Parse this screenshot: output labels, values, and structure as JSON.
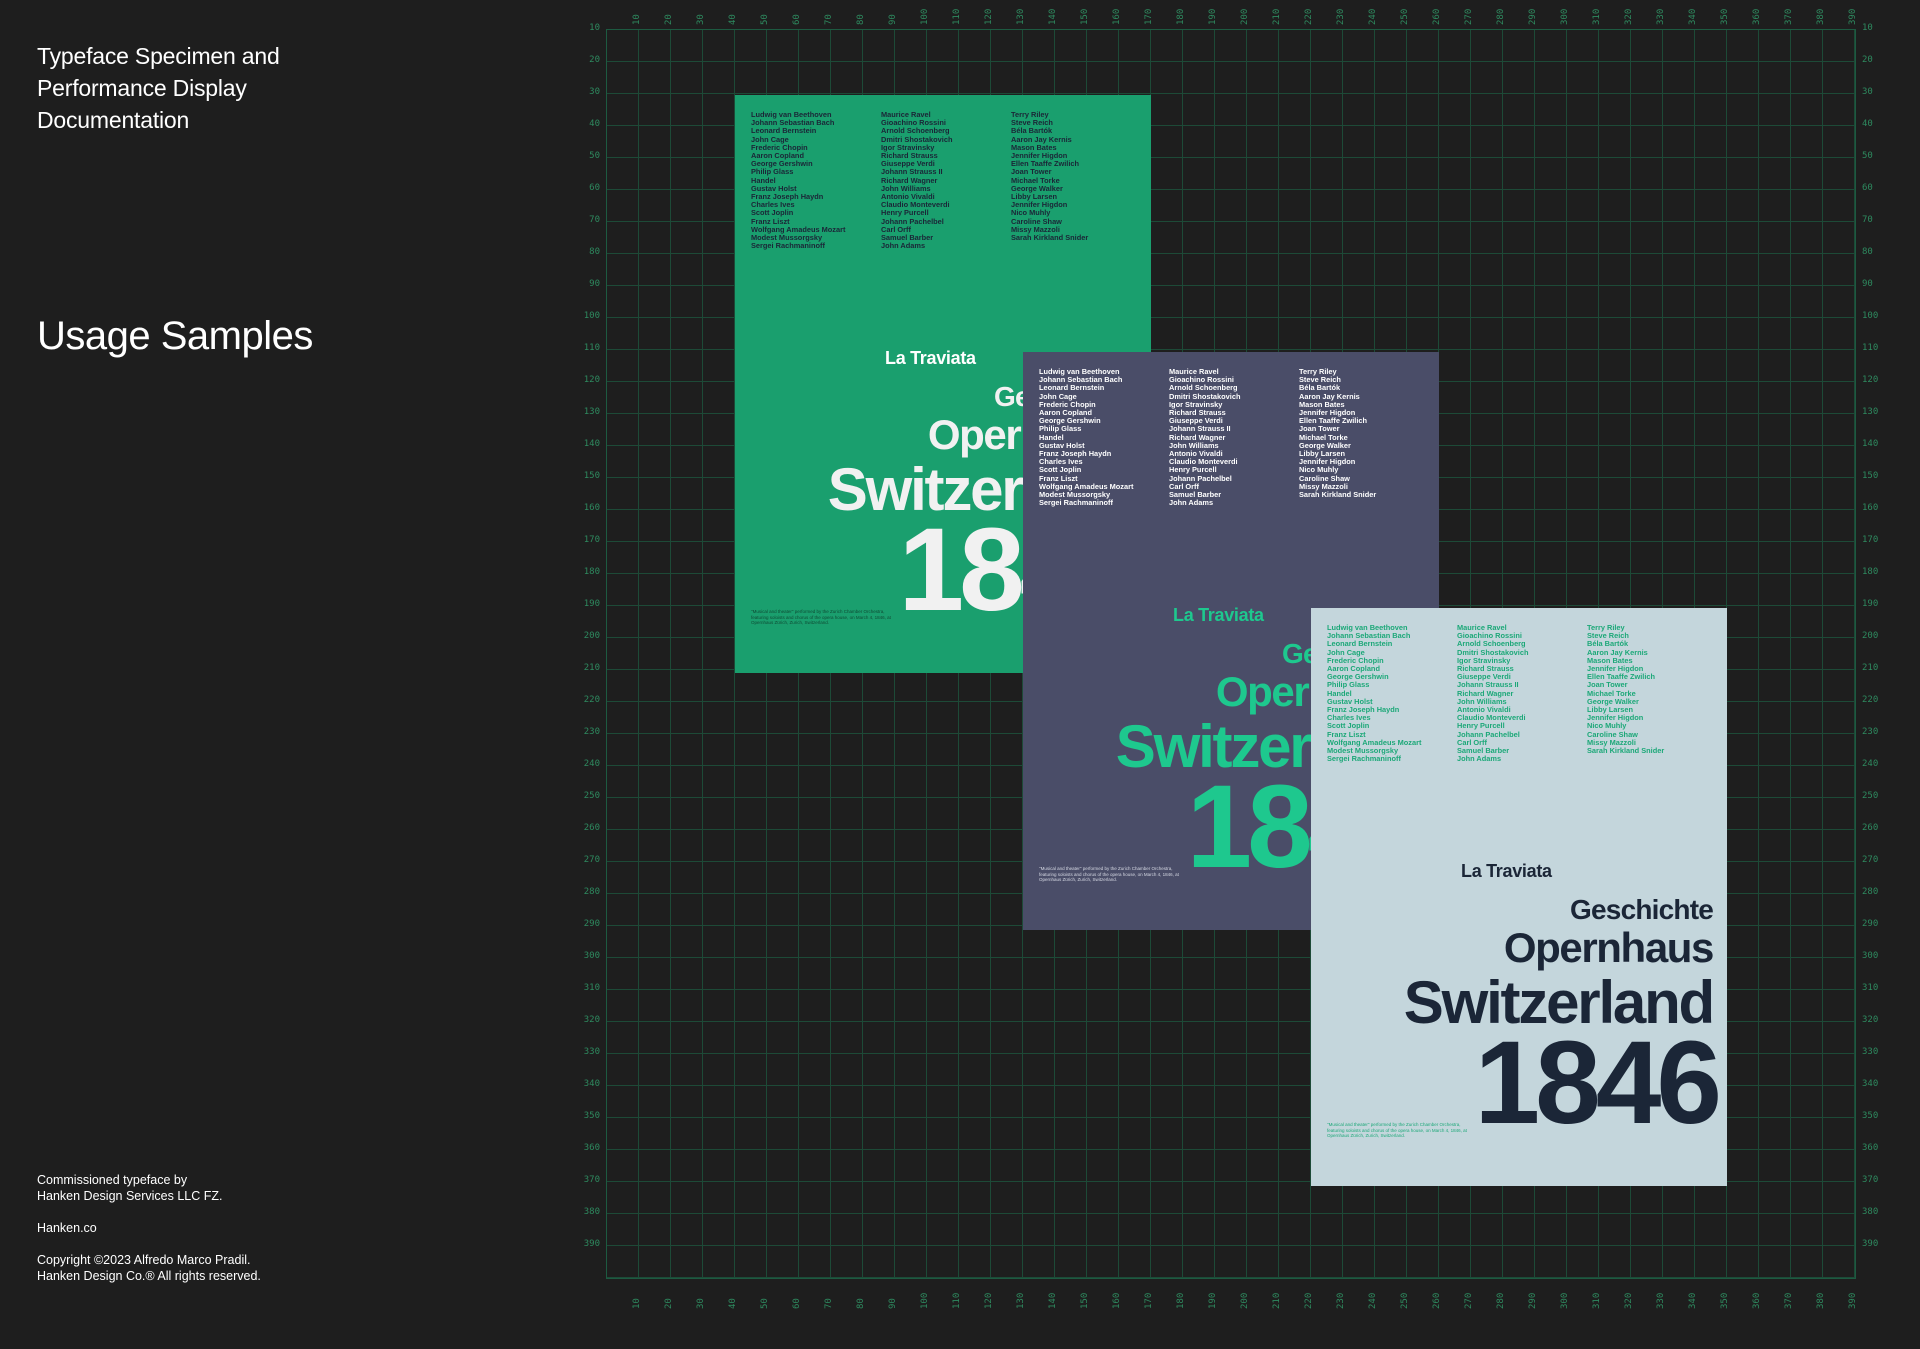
{
  "sidebar": {
    "title_lines": [
      "Typeface Specimen and",
      "Performance Display",
      "Documentation"
    ],
    "section_title": "Usage Samples",
    "credit_lines": [
      "Commissioned typeface by",
      "Hanken Design Services LLC FZ."
    ],
    "website": "Hanken.co",
    "copyright_lines": [
      "Copyright ©2023 Alfredo Marco Pradil.",
      "Hanken Design Co.® All rights reserved."
    ]
  },
  "grid": {
    "ticks": [
      "10",
      "20",
      "30",
      "40",
      "50",
      "60",
      "70",
      "80",
      "90",
      "100",
      "110",
      "120",
      "130",
      "140",
      "150",
      "160",
      "170",
      "180",
      "190",
      "200",
      "210",
      "220",
      "230",
      "240",
      "250",
      "260",
      "270",
      "280",
      "290",
      "300",
      "310",
      "320",
      "330",
      "340",
      "350",
      "360",
      "370",
      "380",
      "390"
    ],
    "line_color": "#1d4a37",
    "tick_color": "#2e8a5f"
  },
  "poster": {
    "composers_col1": [
      "Ludwig van Beethoven",
      "Johann Sebastian Bach",
      "Leonard Bernstein",
      "John Cage",
      "Frederic Chopin",
      "Aaron Copland",
      "George Gershwin",
      "Philip Glass",
      "Handel",
      "Gustav Holst",
      "Franz Joseph Haydn",
      "Charles Ives",
      "Scott Joplin",
      "Franz Liszt",
      "Wolfgang Amadeus Mozart",
      "Modest Mussorgsky",
      "Sergei Rachmaninoff"
    ],
    "composers_col2": [
      "Maurice Ravel",
      "Gioachino Rossini",
      "Arnold Schoenberg",
      "Dmitri Shostakovich",
      "Igor Stravinsky",
      "Richard Strauss",
      "Giuseppe Verdi",
      "Johann Strauss II",
      "Richard Wagner",
      "John Williams",
      "Antonio Vivaldi",
      "Claudio Monteverdi",
      "Henry Purcell",
      "Johann Pachelbel",
      "Carl Orff",
      "Samuel Barber",
      "John Adams"
    ],
    "composers_col3": [
      "Terry Riley",
      "Steve Reich",
      "Béla Bartók",
      "Aaron Jay Kernis",
      "Mason Bates",
      "Jennifer Higdon",
      "Ellen Taaffe Zwilich",
      "Joan Tower",
      "Michael Torke",
      "George Walker",
      "Libby Larsen",
      "Jennifer Higdon",
      "Nico Muhly",
      "Caroline Shaw",
      "Missy Mazzoli",
      "Sarah Kirkland Snider"
    ],
    "opera": "La Traviata",
    "history": "Geschichte",
    "venue": "Opernhaus",
    "country": "Switzerland",
    "year": "1846",
    "note": "\"Musical and theater\" performed by the Zurich Chamber Orchestra, featuring soloists and chorus of the opera house, on March 4, 1846, at Opernhaus Zürich, Zurich, Switzerland."
  },
  "colors": {
    "background": "#1e1e1e",
    "poster_green": "#1a9f6e",
    "poster_slate": "#4a4d68",
    "poster_pale": "#c4d6dc",
    "accent_green": "#1ec88e",
    "ink_navy": "#1b2637"
  }
}
